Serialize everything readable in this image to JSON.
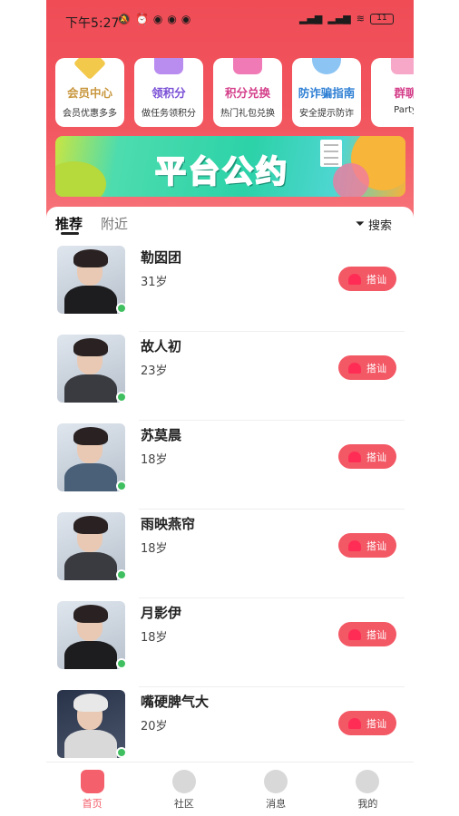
{
  "status_bar": {
    "time": "下午5:27",
    "battery": "11"
  },
  "cards": [
    {
      "title": "会员中心",
      "subtitle": "会员优惠多多",
      "title_color": "#c8963c",
      "icon": "diamond-icon",
      "icon_color": "#f3c94c"
    },
    {
      "title": "领积分",
      "subtitle": "做任务领积分",
      "title_color": "#7a4fd6",
      "icon": "gift-icon",
      "icon_color": "#b98cf0"
    },
    {
      "title": "积分兑换",
      "subtitle": "热门礼包兑换",
      "title_color": "#d43f8a",
      "icon": "shopping-bag-icon",
      "icon_color": "#f07ab5"
    },
    {
      "title": "防诈骗指南",
      "subtitle": "安全提示防诈",
      "title_color": "#2e7fd4",
      "icon": "shield-icon",
      "icon_color": "#8cc4f3"
    },
    {
      "title": "群聊",
      "subtitle": "Party",
      "title_color": "#d43f8a",
      "icon": "group-chat-icon",
      "icon_color": "#f7a8c8"
    }
  ],
  "banner": {
    "title": "平台公约"
  },
  "tabs": {
    "recommend": "推荐",
    "nearby": "附近",
    "search": "搜索"
  },
  "users": [
    {
      "name": "勒囡团",
      "age": "31岁",
      "button": "搭讪",
      "online": true
    },
    {
      "name": "故人初",
      "age": "23岁",
      "button": "搭讪",
      "online": true
    },
    {
      "name": "苏莫晨",
      "age": "18岁",
      "button": "搭讪",
      "online": true
    },
    {
      "name": "雨映燕帘",
      "age": "18岁",
      "button": "搭讪",
      "online": true
    },
    {
      "name": "月影伊",
      "age": "18岁",
      "button": "搭讪",
      "online": true
    },
    {
      "name": "嘴硬脾气大",
      "age": "20岁",
      "button": "搭讪",
      "online": true
    }
  ],
  "tabbar": {
    "home": "首页",
    "community": "社区",
    "messages": "消息",
    "mine": "我的"
  },
  "colors": {
    "accent": "#f35865",
    "online": "#3fbf5f",
    "hero_top": "#ef4c56"
  }
}
